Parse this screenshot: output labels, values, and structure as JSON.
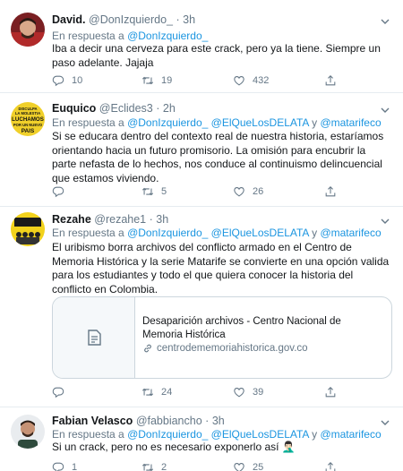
{
  "tweets": [
    {
      "name": "David.",
      "handle": "@DonIzquierdo_",
      "time": "3h",
      "reply_prefix": "En respuesta a",
      "mentions": [
        "@DonIzquierdo_"
      ],
      "text": "Iba a decir una cerveza para este crack, pero ya la tiene. Siempre un paso adelante. Jajaja",
      "replies": "10",
      "retweets": "19",
      "likes": "432"
    },
    {
      "name": "Euquico",
      "handle": "@Eclides3",
      "time": "2h",
      "reply_prefix": "En respuesta a",
      "mentions": [
        "@DonIzquierdo_",
        "@ElQueLosDELATA",
        "@matarifeco"
      ],
      "mention_joiner": "y",
      "text": "Si se educara dentro del contexto real de nuestra historia, estaríamos orientando hacia un futuro promisorio. La omisión para encubrir la parte nefasta de lo hechos, nos conduce al continuismo delincuencial que estamos viviendo.",
      "replies": "",
      "retweets": "5",
      "likes": "26",
      "avatar_text": [
        "DISCULPA",
        "LA MOLESTIA",
        "LUCHAMOS",
        "POR UN NUEVO",
        "PAIS"
      ]
    },
    {
      "name": "Rezahe",
      "handle": "@rezahe1",
      "time": "3h",
      "reply_prefix": "En respuesta a",
      "mentions": [
        "@DonIzquierdo_",
        "@ElQueLosDELATA",
        "@matarifeco"
      ],
      "mention_joiner": "y",
      "text": "El uribismo borra archivos del conflicto armado en el  Centro de Memoria Histórica y la serie Matarife se convierte en una opción valida para los estudiantes y todo el que quiera conocer la historia del conflicto en Colombia.",
      "card": {
        "title": "Desaparición archivos - Centro Nacional de Memoria Histórica",
        "url": "centrodememoriahistorica.gov.co"
      },
      "replies": "",
      "retweets": "24",
      "likes": "39"
    },
    {
      "name": "Fabian Velasco",
      "handle": "@fabbiancho",
      "time": "3h",
      "reply_prefix": "En respuesta a",
      "mentions": [
        "@DonIzquierdo_",
        "@ElQueLosDELATA",
        "@matarifeco"
      ],
      "mention_joiner": "y",
      "text": "Si un crack, pero no es necesario exponerlo así 🤦🏻‍♂️",
      "replies": "1",
      "retweets": "2",
      "likes": "25"
    }
  ],
  "icons": {
    "reply": "reply-icon",
    "retweet": "retweet-icon",
    "like": "heart-icon",
    "share": "share-icon",
    "caret": "chevron-down-icon",
    "link": "link-icon",
    "document": "document-icon"
  },
  "colors": {
    "link": "#1b95e0",
    "secondary": "#657786",
    "text": "#14171a",
    "border": "#e6ecf0"
  }
}
